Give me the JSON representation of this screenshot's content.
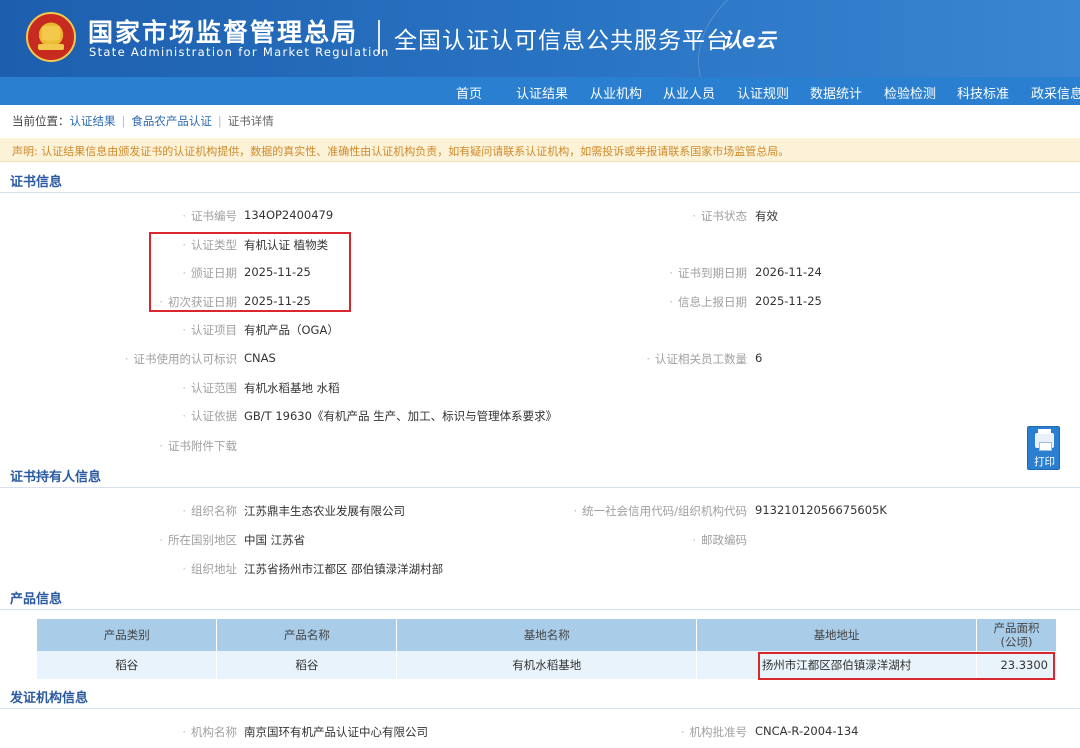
{
  "header": {
    "org_name_cn": "国家市场监督管理总局",
    "org_name_en": "State Administration  for  Market Regulation",
    "platform_title": "全国认证认可信息公共服务平台",
    "platform_logo": "认e云"
  },
  "nav": {
    "items": [
      "首页",
      "认证结果",
      "从业机构",
      "从业人员",
      "认证规则",
      "数据统计",
      "检验检测",
      "科技标准",
      "政采信息"
    ]
  },
  "breadcrumb": {
    "prefix": "当前位置：",
    "items": [
      "认证结果",
      "食品农产品认证",
      "证书详情"
    ]
  },
  "notice": "声明: 认证结果信息由颁发证书的认证机构提供，数据的真实性、准确性由认证机构负责，如有疑问请联系认证机构，如需投诉或举报请联系国家市场监管总局。",
  "cert_info": {
    "title": "证书信息",
    "fields": {
      "cert_no": {
        "label": "证书编号",
        "value": "134OP2400479"
      },
      "cert_status": {
        "label": "证书状态",
        "value": "有效"
      },
      "cert_type": {
        "label": "认证类型",
        "value": "有机认证  植物类"
      },
      "issue_date": {
        "label": "颁证日期",
        "value": "2025-11-25"
      },
      "expire_date": {
        "label": "证书到期日期",
        "value": "2026-11-24"
      },
      "first_date": {
        "label": "初次获证日期",
        "value": "2025-11-25"
      },
      "report_date": {
        "label": "信息上报日期",
        "value": "2025-11-25"
      },
      "cert_item": {
        "label": "认证项目",
        "value": "有机产品（OGA）"
      },
      "accr_mark": {
        "label": "证书使用的认可标识",
        "value": "CNAS"
      },
      "staff_count": {
        "label": "认证相关员工数量",
        "value": "6"
      },
      "scope": {
        "label": "认证范围",
        "value": "有机水稻基地 水稻"
      },
      "basis": {
        "label": "认证依据",
        "value": "GB/T 19630《有机产品 生产、加工、标识与管理体系要求》"
      },
      "attachment": {
        "label": "证书附件下载",
        "value": ""
      }
    }
  },
  "holder_info": {
    "title": "证书持有人信息",
    "fields": {
      "org_name": {
        "label": "组织名称",
        "value": "江苏鼎丰生态农业发展有限公司"
      },
      "credit_code": {
        "label": "统一社会信用代码/组织机构代码",
        "value": "91321012056675605K"
      },
      "region": {
        "label": "所在国别地区",
        "value": "中国 江苏省"
      },
      "postcode": {
        "label": "邮政编码",
        "value": ""
      },
      "address": {
        "label": "组织地址",
        "value": "江苏省扬州市江都区 邵伯镇渌洋湖村部"
      }
    }
  },
  "product_info": {
    "title": "产品信息",
    "columns": [
      "产品类别",
      "产品名称",
      "基地名称",
      "基地地址",
      "产品面积",
      "(公顷)"
    ],
    "rows": [
      {
        "category": "稻谷",
        "name": "稻谷",
        "base_name": "有机水稻基地",
        "base_address": "扬州市江都区邵伯镇渌洋湖村",
        "area": "23.3300"
      }
    ]
  },
  "issuer_info": {
    "title": "发证机构信息",
    "fields": {
      "org_name": {
        "label": "机构名称",
        "value": "南京国环有机产品认证中心有限公司"
      },
      "approval_no": {
        "label": "机构批准号",
        "value": "CNCA-R-2004-134"
      }
    }
  },
  "print_button": {
    "label": "打印",
    "icon": "printer-icon"
  },
  "colors": {
    "header_blue": "#1d5fae",
    "nav_blue": "#2a7fd0",
    "section_title": "#2c5aa0",
    "highlight_red": "#d9272e",
    "notice_text": "#d08a2a"
  }
}
